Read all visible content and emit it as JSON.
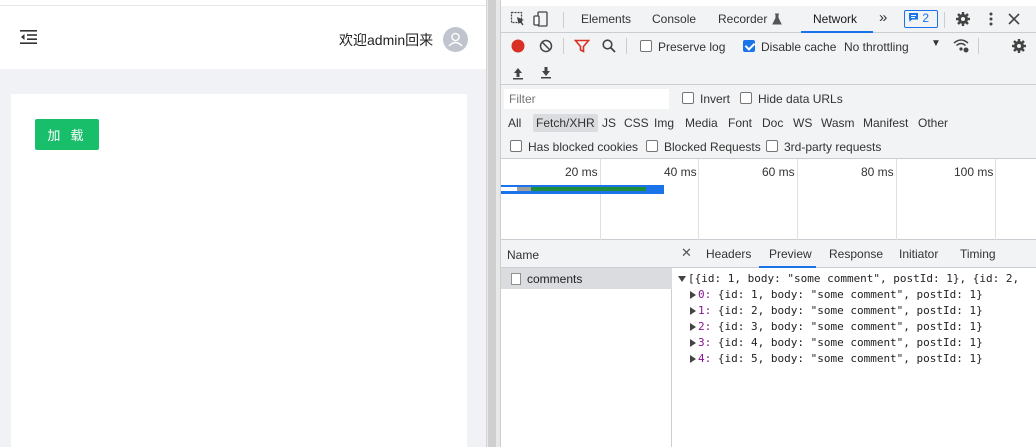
{
  "app": {
    "welcome_text": "欢迎admin回来",
    "load_button": "加 载"
  },
  "devtools": {
    "tabs": [
      "Elements",
      "Console",
      "Recorder",
      "Network"
    ],
    "active_tab": "Network",
    "more_tabs_glyph": "»",
    "issues_count": "2",
    "toolbar": {
      "preserve_log": "Preserve log",
      "preserve_log_checked": false,
      "disable_cache": "Disable cache",
      "disable_cache_checked": true,
      "throttling": "No throttling"
    },
    "filter": {
      "placeholder": "Filter",
      "invert": "Invert",
      "hide_data_urls": "Hide data URLs",
      "types": [
        "All",
        "Fetch/XHR",
        "JS",
        "CSS",
        "Img",
        "Media",
        "Font",
        "Doc",
        "WS",
        "Wasm",
        "Manifest",
        "Other"
      ],
      "active_type": "Fetch/XHR",
      "has_blocked_cookies": "Has blocked cookies",
      "blocked_requests": "Blocked Requests",
      "third_party": "3rd-party requests"
    },
    "timeline": {
      "ticks": [
        "20 ms",
        "40 ms",
        "60 ms",
        "80 ms",
        "100 ms"
      ]
    },
    "requests": {
      "header": "Name",
      "items": [
        "comments"
      ]
    },
    "detail": {
      "tabs": [
        "Headers",
        "Preview",
        "Response",
        "Initiator",
        "Timing"
      ],
      "active_tab": "Preview",
      "summary": "[{id: 1, body: \"some comment\", postId: 1}, {id: 2,",
      "items": [
        {
          "index": "0:",
          "value": "{id: 1, body: \"some comment\", postId: 1}"
        },
        {
          "index": "1:",
          "value": "{id: 2, body: \"some comment\", postId: 1}"
        },
        {
          "index": "2:",
          "value": "{id: 3, body: \"some comment\", postId: 1}"
        },
        {
          "index": "3:",
          "value": "{id: 4, body: \"some comment\", postId: 1}"
        },
        {
          "index": "4:",
          "value": "{id: 5, body: \"some comment\", postId: 1}"
        }
      ]
    }
  }
}
